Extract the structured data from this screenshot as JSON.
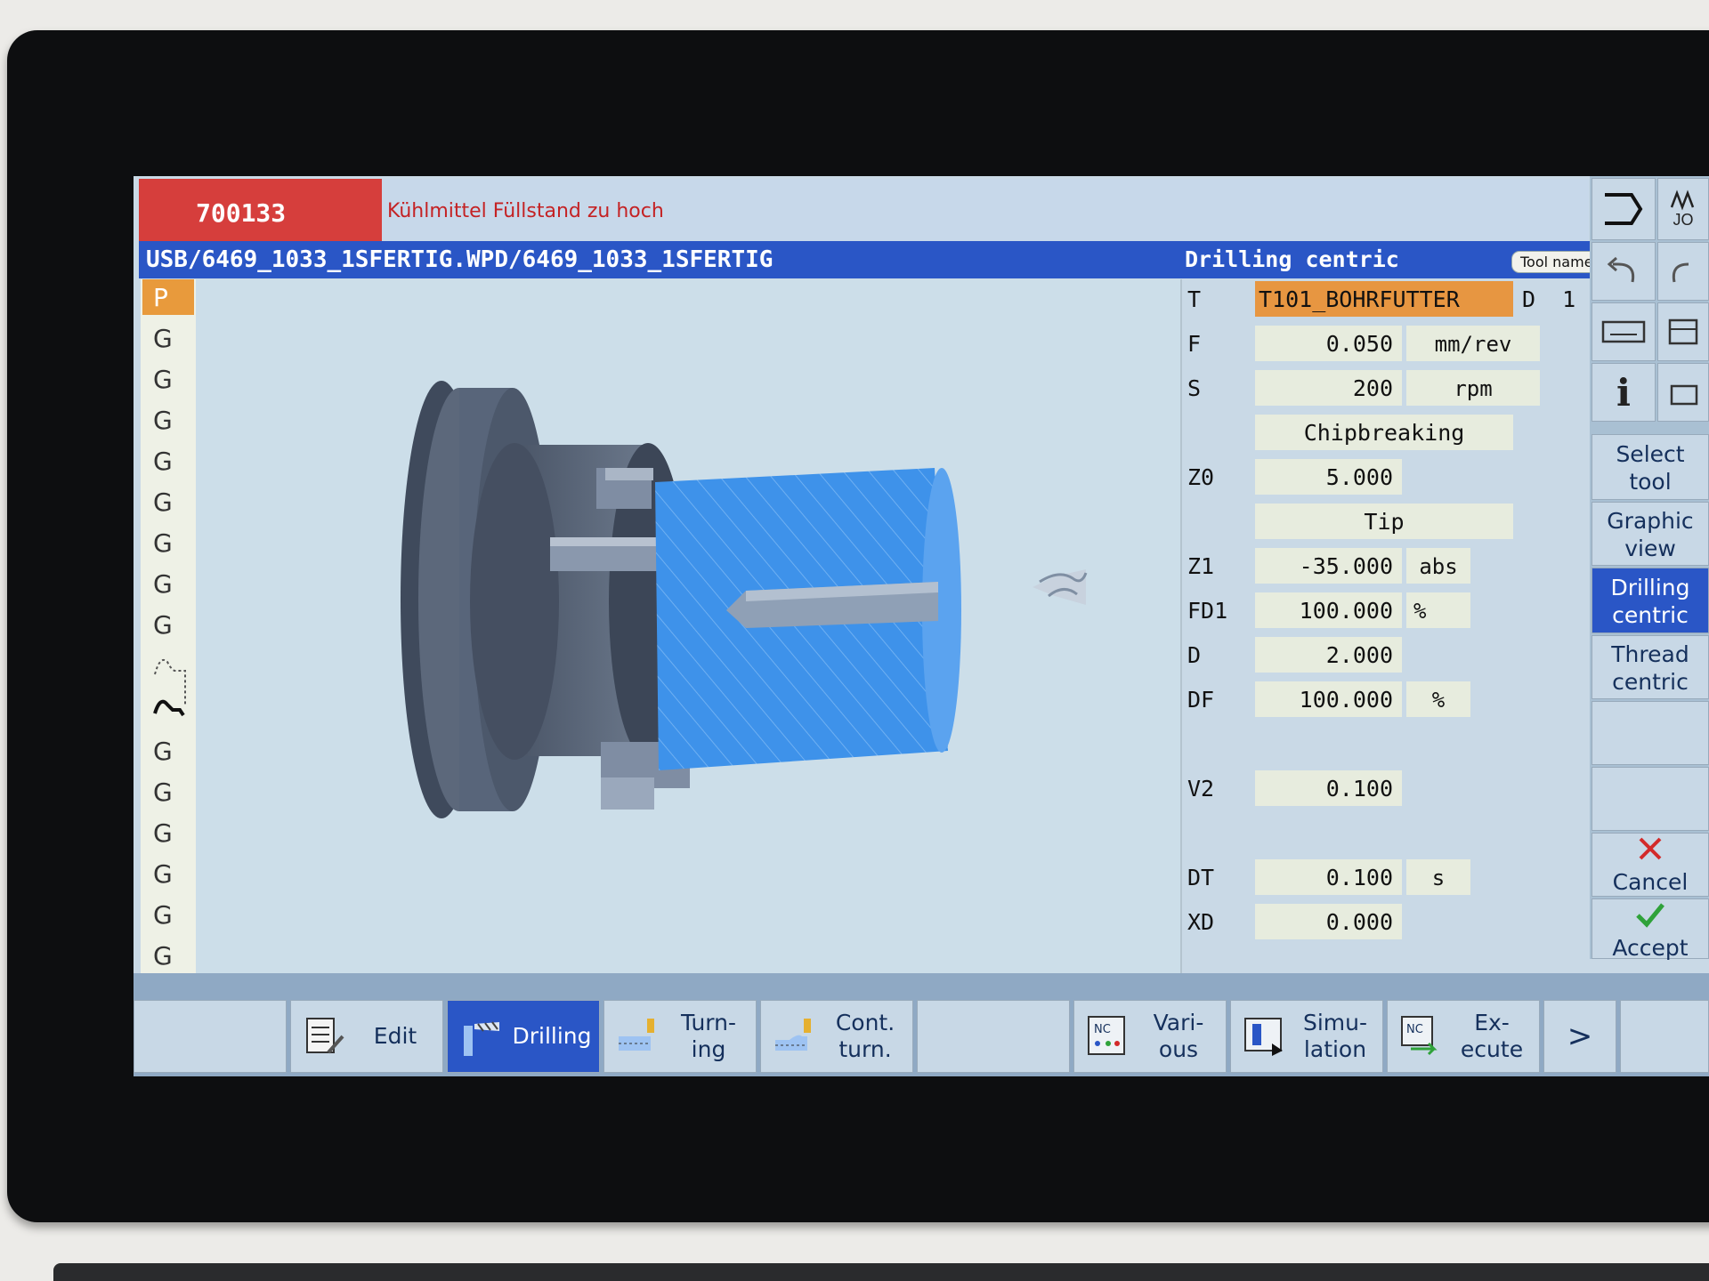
{
  "alarm": {
    "number": "700133",
    "message": "Kühlmittel Füllstand zu hoch"
  },
  "title": {
    "path": "USB/6469_1033_1SFERTIG.WPD/6469_1033_1SFERTIG",
    "cycle": "Drilling centric",
    "tool_name_chip": "Tool name"
  },
  "blocks": {
    "items": [
      "P",
      "G",
      "G",
      "G",
      "G",
      "G",
      "G",
      "G",
      "G",
      "G",
      "G",
      "G",
      "G",
      "G",
      "G"
    ],
    "active_index": 0
  },
  "params": {
    "T": {
      "label": "T",
      "value": "T101_BOHRFUTTER",
      "d_label": "D",
      "d_value": "1"
    },
    "F": {
      "label": "F",
      "value": "0.050",
      "unit": "mm/rev"
    },
    "S": {
      "label": "S",
      "value": "200",
      "unit": "rpm"
    },
    "chipbreaking": "Chipbreaking",
    "Z0": {
      "label": "Z0",
      "value": "5.000"
    },
    "tip": "Tip",
    "Z1": {
      "label": "Z1",
      "value": "-35.000",
      "unit": "abs"
    },
    "FD1": {
      "label": "FD1",
      "value": "100.000",
      "unit": "%"
    },
    "D": {
      "label": "D",
      "value": "2.000"
    },
    "DF": {
      "label": "DF",
      "value": "100.000",
      "unit": "%"
    },
    "V2": {
      "label": "V2",
      "value": "0.100"
    },
    "DT": {
      "label": "DT",
      "value": "0.100",
      "unit": "s"
    },
    "XD": {
      "label": "XD",
      "value": "0.000"
    }
  },
  "vertical_softkeys": {
    "jog": "JO",
    "select_tool": [
      "Select",
      "tool"
    ],
    "graphic_view": [
      "Graphic",
      "view"
    ],
    "drilling_centric": [
      "Drilling",
      "centric"
    ],
    "thread_centric": [
      "Thread",
      "centric"
    ],
    "cancel": "Cancel",
    "accept": "Accept",
    "info": "i"
  },
  "horizontal_softkeys": {
    "edit": "Edit",
    "drilling": "Drilling",
    "turning": [
      "Turn-",
      "ing"
    ],
    "cont_turn": [
      "Cont.",
      "turn."
    ],
    "various": [
      "Vari-",
      "ous"
    ],
    "simulation": [
      "Simu-",
      "lation"
    ],
    "execute": [
      "Ex-",
      "ecute"
    ],
    "more": ">",
    "nc": "NC"
  },
  "colors": {
    "alarm_red": "#d63e3c",
    "title_blue": "#2a56c6",
    "active_orange": "#e79641",
    "field_bg": "#e7ecde",
    "workpiece_blue": "#3e92ea",
    "chuck_gray": "#596678"
  }
}
